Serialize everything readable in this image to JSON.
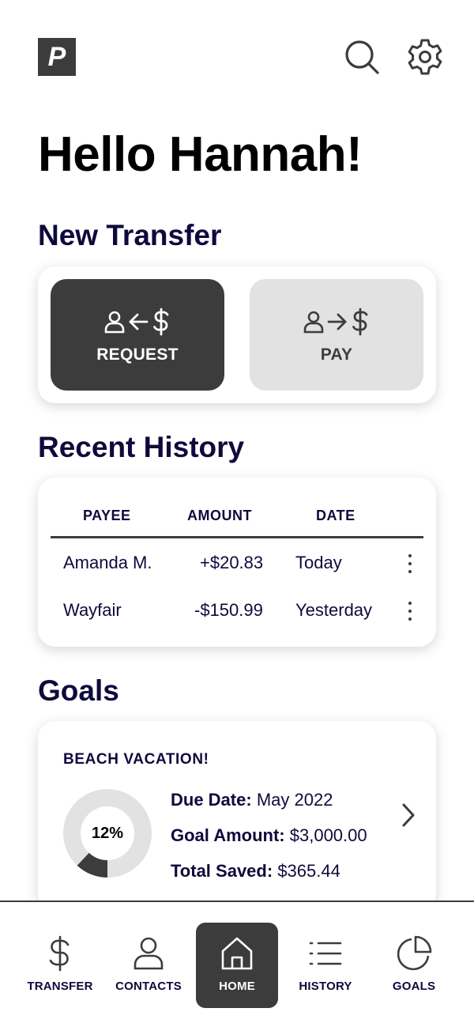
{
  "header": {
    "logo_letter": "P",
    "search_icon": "search-icon",
    "settings_icon": "gear-icon"
  },
  "greeting": "Hello Hannah!",
  "new_transfer": {
    "title": "New Transfer",
    "request": {
      "label": "REQUEST",
      "icons": [
        "person-icon",
        "arrow-left-icon",
        "dollar-icon"
      ]
    },
    "pay": {
      "label": "PAY",
      "icons": [
        "person-icon",
        "arrow-right-icon",
        "dollar-icon"
      ]
    }
  },
  "recent_history": {
    "title": "Recent History",
    "columns": [
      "PAYEE",
      "AMOUNT",
      "DATE"
    ],
    "rows": [
      {
        "payee": "Amanda M.",
        "amount": "+$20.83",
        "date": "Today"
      },
      {
        "payee": "Wayfair",
        "amount": "-$150.99",
        "date": "Yesterday"
      }
    ]
  },
  "goals": {
    "title": "Goals",
    "goal": {
      "name": "BEACH VACATION!",
      "progress_label": "12%",
      "progress": 0.12,
      "due_date_label": "Due Date:",
      "due_date": "May 2022",
      "goal_amount_label": "Goal Amount:",
      "goal_amount": "$3,000.00",
      "total_saved_label": "Total Saved:",
      "total_saved": "$365.44"
    }
  },
  "bottom_nav": {
    "items": [
      {
        "label": "TRANSFER",
        "icon": "dollar-icon"
      },
      {
        "label": "CONTACTS",
        "icon": "person-icon"
      },
      {
        "label": "HOME",
        "icon": "home-icon",
        "active": true
      },
      {
        "label": "HISTORY",
        "icon": "list-icon"
      },
      {
        "label": "GOALS",
        "icon": "pie-chart-icon"
      }
    ]
  },
  "colors": {
    "dark": "#3c3c3c",
    "navy_text": "#0f0a3c",
    "light_gray": "#e2e2e2",
    "background": "#ffffff"
  }
}
